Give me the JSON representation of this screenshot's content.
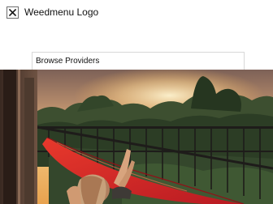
{
  "header": {
    "logo_alt_text": "Weedmenu Logo",
    "logo_icon": "broken-image-icon"
  },
  "nav": {
    "browse_label": "Browse Providers"
  },
  "hero": {
    "scene": "woman-in-red-hammock-on-balcony-at-sunset"
  },
  "colors": {
    "sky_top": "#8a6a58",
    "sky_glow": "#f2b45a",
    "hammock": "#d8262b",
    "foliage": "#2f4a2c"
  }
}
